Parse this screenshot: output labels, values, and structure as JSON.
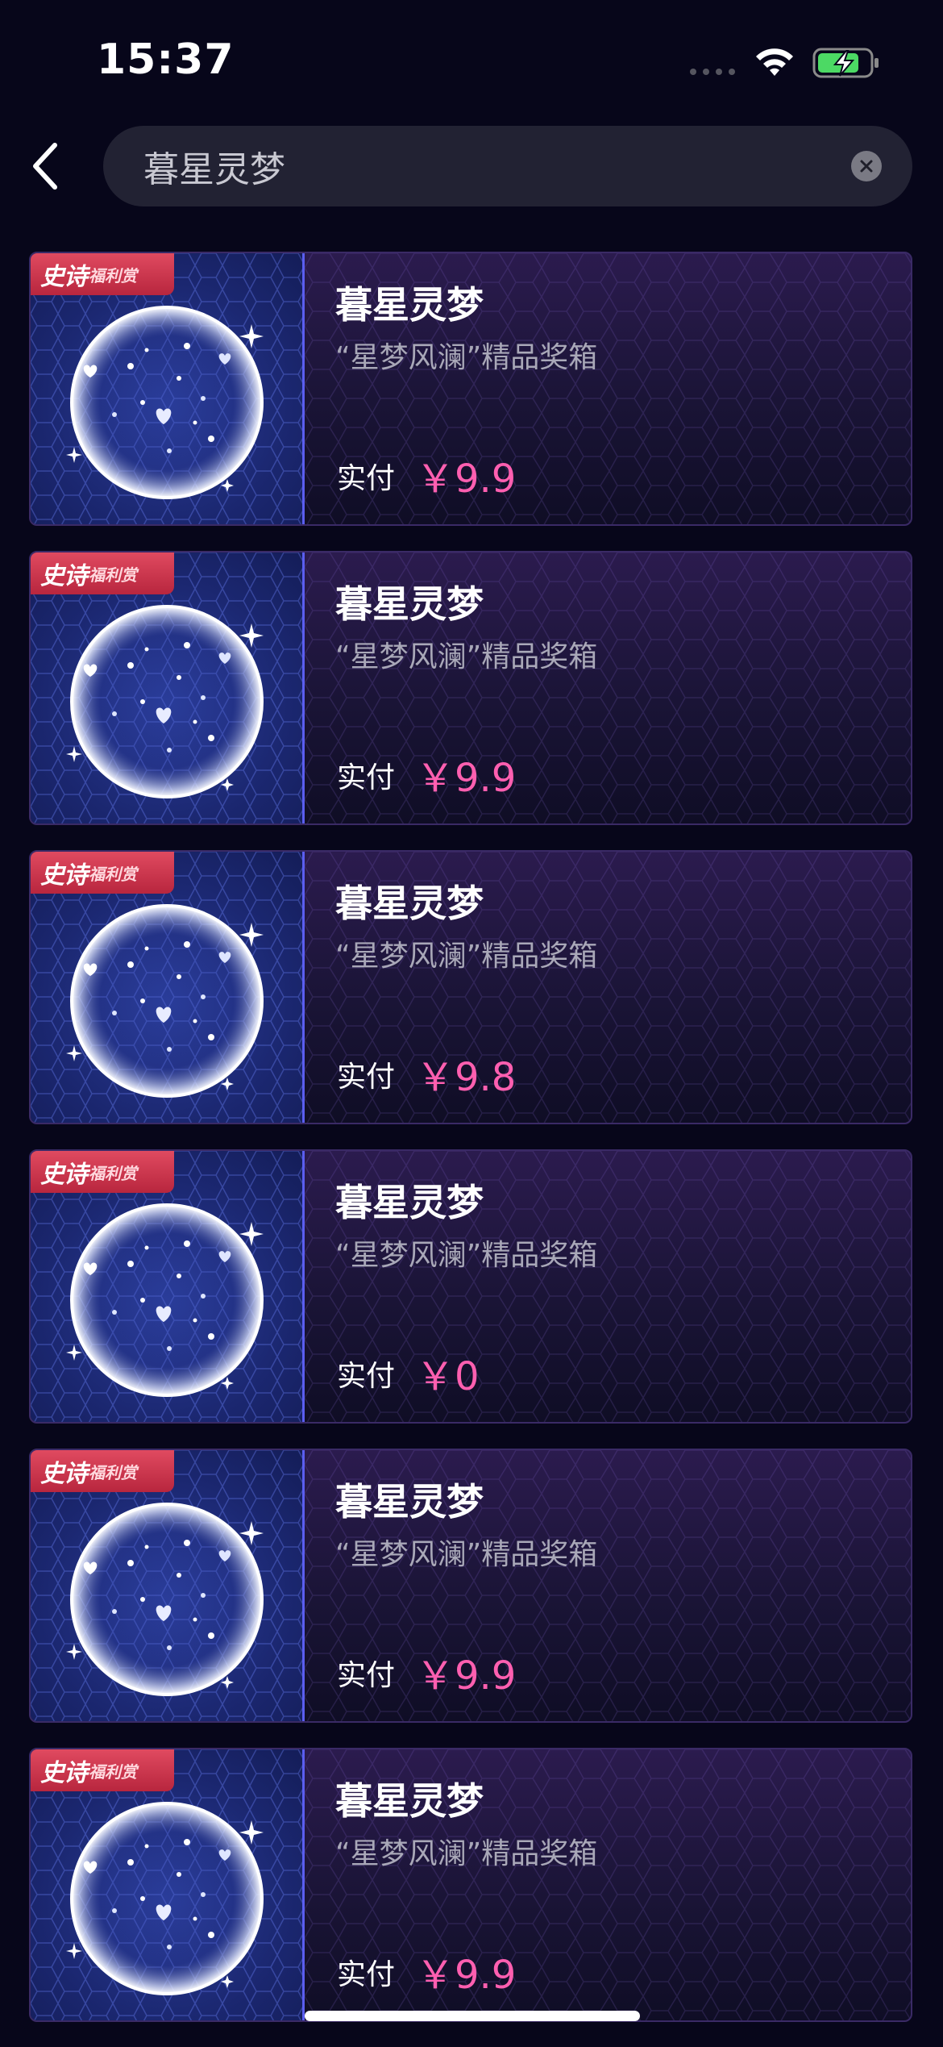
{
  "status_bar": {
    "time": "15:37"
  },
  "search": {
    "query": "暮星灵梦"
  },
  "products": [
    {
      "badge_main": "史诗",
      "badge_sub": "福利赏",
      "title": "暮星灵梦",
      "subtitle": "“星梦风澜”精品奖箱",
      "pay_label": "实付",
      "price": "￥9.9"
    },
    {
      "badge_main": "史诗",
      "badge_sub": "福利赏",
      "title": "暮星灵梦",
      "subtitle": "“星梦风澜”精品奖箱",
      "pay_label": "实付",
      "price": "￥9.9"
    },
    {
      "badge_main": "史诗",
      "badge_sub": "福利赏",
      "title": "暮星灵梦",
      "subtitle": "“星梦风澜”精品奖箱",
      "pay_label": "实付",
      "price": "￥9.8"
    },
    {
      "badge_main": "史诗",
      "badge_sub": "福利赏",
      "title": "暮星灵梦",
      "subtitle": "“星梦风澜”精品奖箱",
      "pay_label": "实付",
      "price": "￥0"
    },
    {
      "badge_main": "史诗",
      "badge_sub": "福利赏",
      "title": "暮星灵梦",
      "subtitle": "“星梦风澜”精品奖箱",
      "pay_label": "实付",
      "price": "￥9.9"
    },
    {
      "badge_main": "史诗",
      "badge_sub": "福利赏",
      "title": "暮星灵梦",
      "subtitle": "“星梦风澜”精品奖箱",
      "pay_label": "实付",
      "price": "￥9.9"
    }
  ],
  "colors": {
    "background": "#07061a",
    "price": "#ff5fb0",
    "badge": "#d23a52",
    "thumb_border": "#5b5ef0"
  },
  "icons": {
    "back": "chevron-left-icon",
    "clear": "close-circle-icon",
    "wifi": "wifi-icon",
    "battery": "battery-charging-icon",
    "signal": "signal-dots-icon",
    "product_image": "starry-orb-icon"
  }
}
